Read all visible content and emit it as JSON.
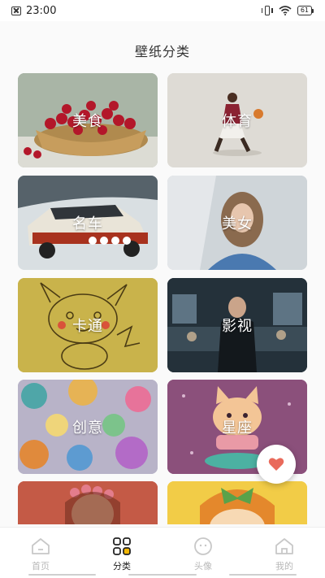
{
  "status_bar": {
    "time": "23:00",
    "battery_level": "61"
  },
  "page": {
    "title": "壁纸分类"
  },
  "categories": [
    {
      "label": "美食",
      "scene": "cherries-in-basket"
    },
    {
      "label": "体育",
      "scene": "basketball-player"
    },
    {
      "label": "名车",
      "scene": "rally-car-in-snow"
    },
    {
      "label": "美女",
      "scene": "girl-in-snow"
    },
    {
      "label": "卡通",
      "scene": "pikachu-sketch"
    },
    {
      "label": "影视",
      "scene": "movie-still"
    },
    {
      "label": "创意",
      "scene": "cupcakes-pattern"
    },
    {
      "label": "星座",
      "scene": "cartoon-cat"
    },
    {
      "label": "",
      "scene": "girl-with-flower-crown"
    },
    {
      "label": "",
      "scene": "cartoon-girl-with-bow"
    }
  ],
  "fab": {
    "icon": "heart-icon",
    "color": "#e96a5b"
  },
  "tab_bar": {
    "tabs": [
      {
        "label": "首页",
        "icon": "home-icon",
        "active": false
      },
      {
        "label": "分类",
        "icon": "category-grid-icon",
        "active": true
      },
      {
        "label": "头像",
        "icon": "avatar-icon",
        "active": false
      },
      {
        "label": "我的",
        "icon": "profile-home-icon",
        "active": false
      }
    ]
  },
  "colors": {
    "active_tab_accent": "#f2b705",
    "inactive_tab": "#c8c8c8"
  }
}
